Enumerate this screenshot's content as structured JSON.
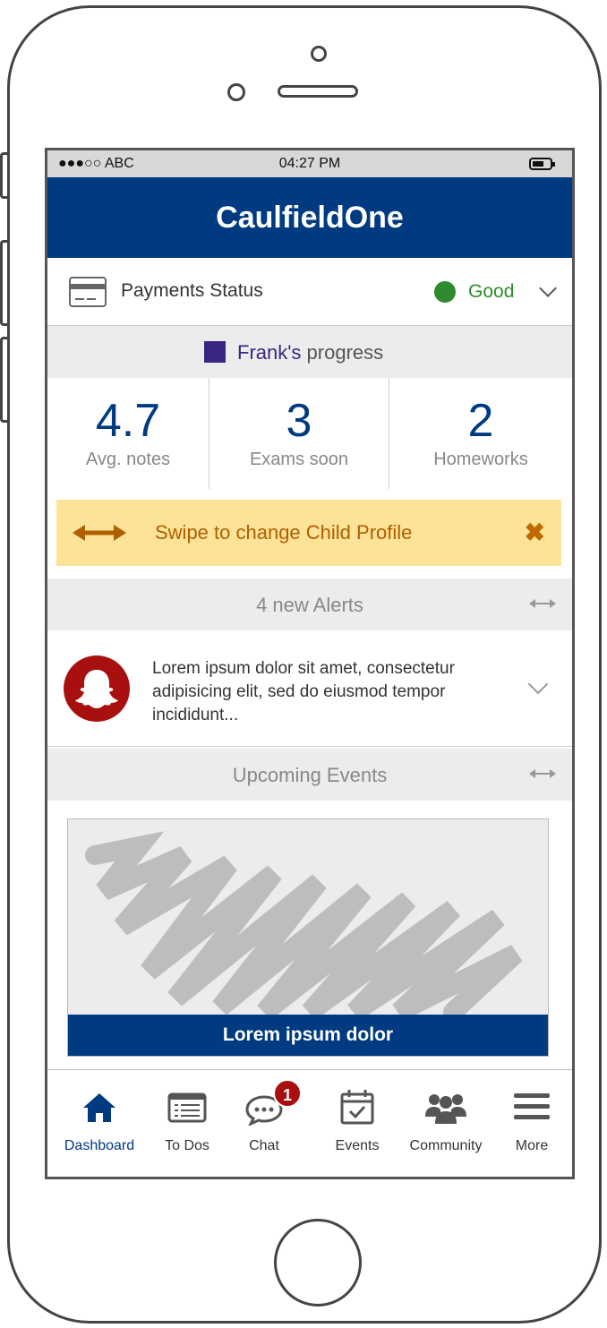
{
  "status_bar": {
    "carrier": "●●●○○ ABC",
    "time": "04:27 PM"
  },
  "app": {
    "title": "CaulfieldOne",
    "brand_color": "#003a80"
  },
  "payments": {
    "label": "Payments Status",
    "status": "Good",
    "status_color": "#2e8b2e"
  },
  "progress": {
    "name": "Frank's",
    "suffix": " progress",
    "stats": [
      {
        "value": "4.7",
        "label": "Avg. notes"
      },
      {
        "value": "3",
        "label": "Exams soon"
      },
      {
        "value": "2",
        "label": "Homeworks"
      }
    ]
  },
  "banner": {
    "text": "Swipe to change Child Profile",
    "close_glyph": "✖"
  },
  "alerts": {
    "header": "4 new Alerts",
    "items": [
      {
        "text": "Lorem ipsum dolor sit amet, consectetur adipisicing elit, sed do eiusmod tempor incididunt..."
      }
    ]
  },
  "events": {
    "header": "Upcoming Events",
    "card_caption": "Lorem ipsum dolor"
  },
  "tabbar": {
    "tabs": [
      {
        "label": "Dashboard",
        "icon": "home-icon",
        "active": true
      },
      {
        "label": "To Dos",
        "icon": "list-icon"
      },
      {
        "label": "Chat",
        "icon": "chat-icon",
        "badge": "1"
      },
      {
        "label": "Events",
        "icon": "calendar-check-icon"
      },
      {
        "label": "Community",
        "icon": "users-icon"
      },
      {
        "label": "More",
        "icon": "menu-icon"
      }
    ]
  }
}
